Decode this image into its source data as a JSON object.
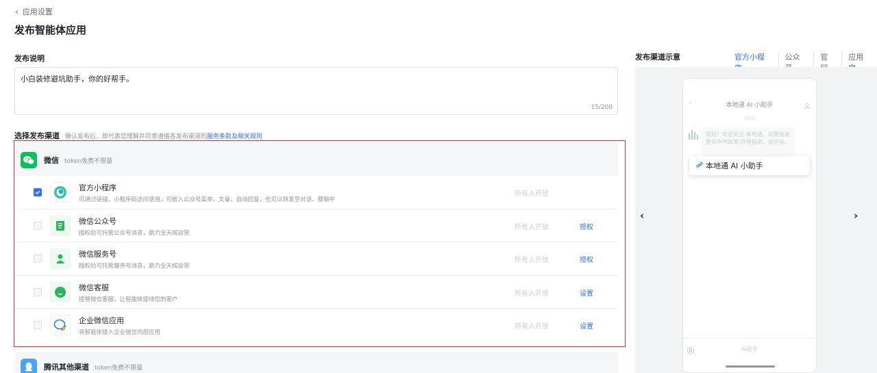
{
  "header": {
    "back_label": "应用设置",
    "title": "发布智能体应用"
  },
  "description": {
    "label": "发布说明",
    "value": "小白装修避坑助手，你的好帮手。",
    "count": "15/200"
  },
  "channels": {
    "label": "选择发布渠道",
    "note": "确认发布后，即代表您理解并同意遵循各发布渠道的",
    "note_link": "服务条款及相关规则",
    "wechat": {
      "name": "微信",
      "sub": "token免费不限量",
      "icon_color": "#07c160",
      "items": [
        {
          "name": "官方小程序",
          "desc": "可通过链接、小程序码访问使用，可嵌入公众号菜单、文章、自动回复，也可以转发至对话、群聊中",
          "access": "所有人开放",
          "action": "",
          "checked": true,
          "icon": "mini-program-icon"
        },
        {
          "name": "微信公众号",
          "desc": "授权后可托管公众号消息，助力全天候运营",
          "access": "所有人开放",
          "action": "授权",
          "checked": false,
          "icon": "official-account-icon"
        },
        {
          "name": "微信服务号",
          "desc": "授权后可托管服务号消息，助力全天候运营",
          "access": "所有人开放",
          "action": "授权",
          "checked": false,
          "icon": "service-account-icon"
        },
        {
          "name": "微信客服",
          "desc": "接管微信客服，让智能体接待您的客户",
          "access": "所有人开放",
          "action": "设置",
          "checked": false,
          "icon": "customer-service-icon"
        },
        {
          "name": "企业微信应用",
          "desc": "将智能体接入企业微信内部应用",
          "access": "所有人开放",
          "action": "设置",
          "checked": false,
          "icon": "wecom-icon"
        }
      ]
    },
    "tencent": {
      "name": "腾讯其他渠道",
      "sub": "token免费不限量",
      "icon_color": "#4aa3f4"
    }
  },
  "preview": {
    "label": "发布渠道示意",
    "tabs": [
      "官方小程序",
      "公众号",
      "官网",
      "应用宝"
    ],
    "active_tab": "官方小程序",
    "phone": {
      "title": "本地通 AI 小助手",
      "subtitle": "05/2",
      "bubble": "您好！欢迎关注 本地通。如需快速查询本地政策/办理指南，请咨询。",
      "popup": "本地通 AI 小助手",
      "bottom_label": "AI助手"
    }
  },
  "colors": {
    "accent": "#3370ff",
    "frame": "#d0302f"
  }
}
